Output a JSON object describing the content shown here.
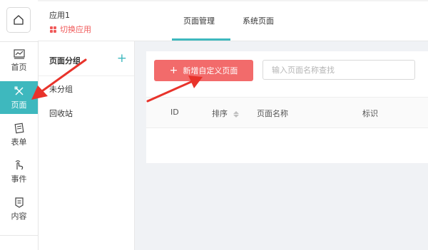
{
  "app": {
    "name": "应用1",
    "switch_label": "切换应用"
  },
  "top_tabs": [
    {
      "label": "页面管理",
      "active": true
    },
    {
      "label": "系统页面",
      "active": false
    }
  ],
  "rail": {
    "items": [
      {
        "label": "首页",
        "icon": "chart-icon",
        "active": false
      },
      {
        "label": "页面",
        "icon": "pencil-ruler-icon",
        "active": true
      },
      {
        "label": "表单",
        "icon": "form-icon",
        "active": false
      },
      {
        "label": "事件",
        "icon": "hand-pointer-icon",
        "active": false
      },
      {
        "label": "内容",
        "icon": "content-doc-icon",
        "active": false
      }
    ]
  },
  "group_panel": {
    "title": "页面分组",
    "items": [
      "未分组",
      "回收站"
    ]
  },
  "main": {
    "add_button_label": "新增自定义页面",
    "search_placeholder": "输入页面名称查找",
    "columns": [
      "ID",
      "排序",
      "页面名称",
      "标识"
    ]
  },
  "colors": {
    "accent": "#3eb8be",
    "primary_button": "#f26b6b",
    "switch_text": "#f05a5a",
    "annotation_arrow": "#e8332b"
  }
}
